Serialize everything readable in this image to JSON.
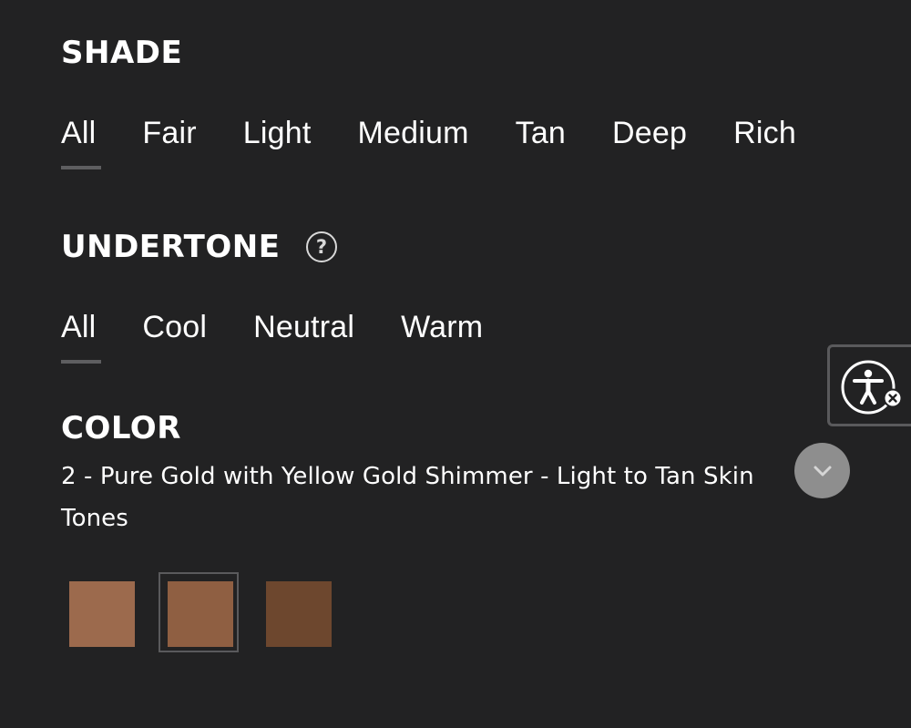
{
  "shade": {
    "heading": "SHADE",
    "options": [
      "All",
      "Fair",
      "Light",
      "Medium",
      "Tan",
      "Deep",
      "Rich"
    ],
    "selected": "All"
  },
  "undertone": {
    "heading": "UNDERTONE",
    "help_symbol": "?",
    "options": [
      "All",
      "Cool",
      "Neutral",
      "Warm"
    ],
    "selected": "All"
  },
  "color": {
    "heading": "COLOR",
    "selected_name": "2 - Pure Gold with Yellow Gold Shimmer - Light to Tan Skin Tones",
    "dropdown_icon": "chevron-down-icon",
    "swatches": [
      {
        "color": "#9c6a4d",
        "selected": false
      },
      {
        "color": "#8f5f42",
        "selected": true
      },
      {
        "color": "#6d472e",
        "selected": false
      }
    ]
  },
  "accessibility": {
    "icon": "accessibility-icon",
    "close_icon": "close-icon"
  },
  "colors": {
    "background": "#222223",
    "text": "#ffffff",
    "underline": "#5e5e60",
    "dropdown_bg": "#8e8e8e"
  }
}
